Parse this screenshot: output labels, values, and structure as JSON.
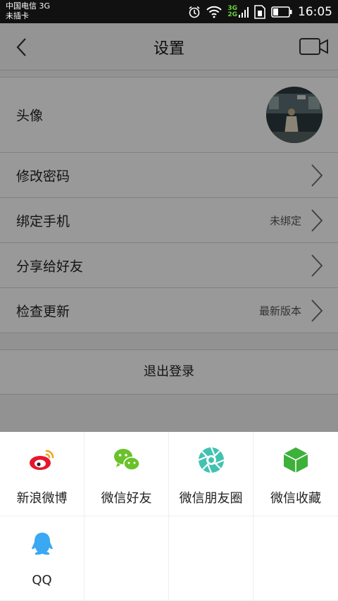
{
  "status_bar": {
    "carrier_line1": "中国电信 3G",
    "carrier_line2": "未插卡",
    "net_3g": "3G",
    "net_2g": "2G",
    "time": "16:05"
  },
  "navbar": {
    "title": "设置"
  },
  "settings": {
    "avatar_label": "头像",
    "items": [
      {
        "label": "修改密码",
        "value": ""
      },
      {
        "label": "绑定手机",
        "value": "未绑定"
      },
      {
        "label": "分享给好友",
        "value": ""
      },
      {
        "label": "检查更新",
        "value": "最新版本"
      }
    ],
    "logout_label": "退出登录"
  },
  "share_sheet": {
    "items": [
      {
        "label": "新浪微博",
        "icon": "weibo-icon",
        "color": "#e6162d"
      },
      {
        "label": "微信好友",
        "icon": "wechat-icon",
        "color": "#6ac22a"
      },
      {
        "label": "微信朋友圈",
        "icon": "moments-icon",
        "color": "#41c2b1"
      },
      {
        "label": "微信收藏",
        "icon": "favorites-icon",
        "color": "#3db13a"
      },
      {
        "label": "QQ",
        "icon": "qq-icon",
        "color": "#3aa8f2"
      }
    ]
  }
}
